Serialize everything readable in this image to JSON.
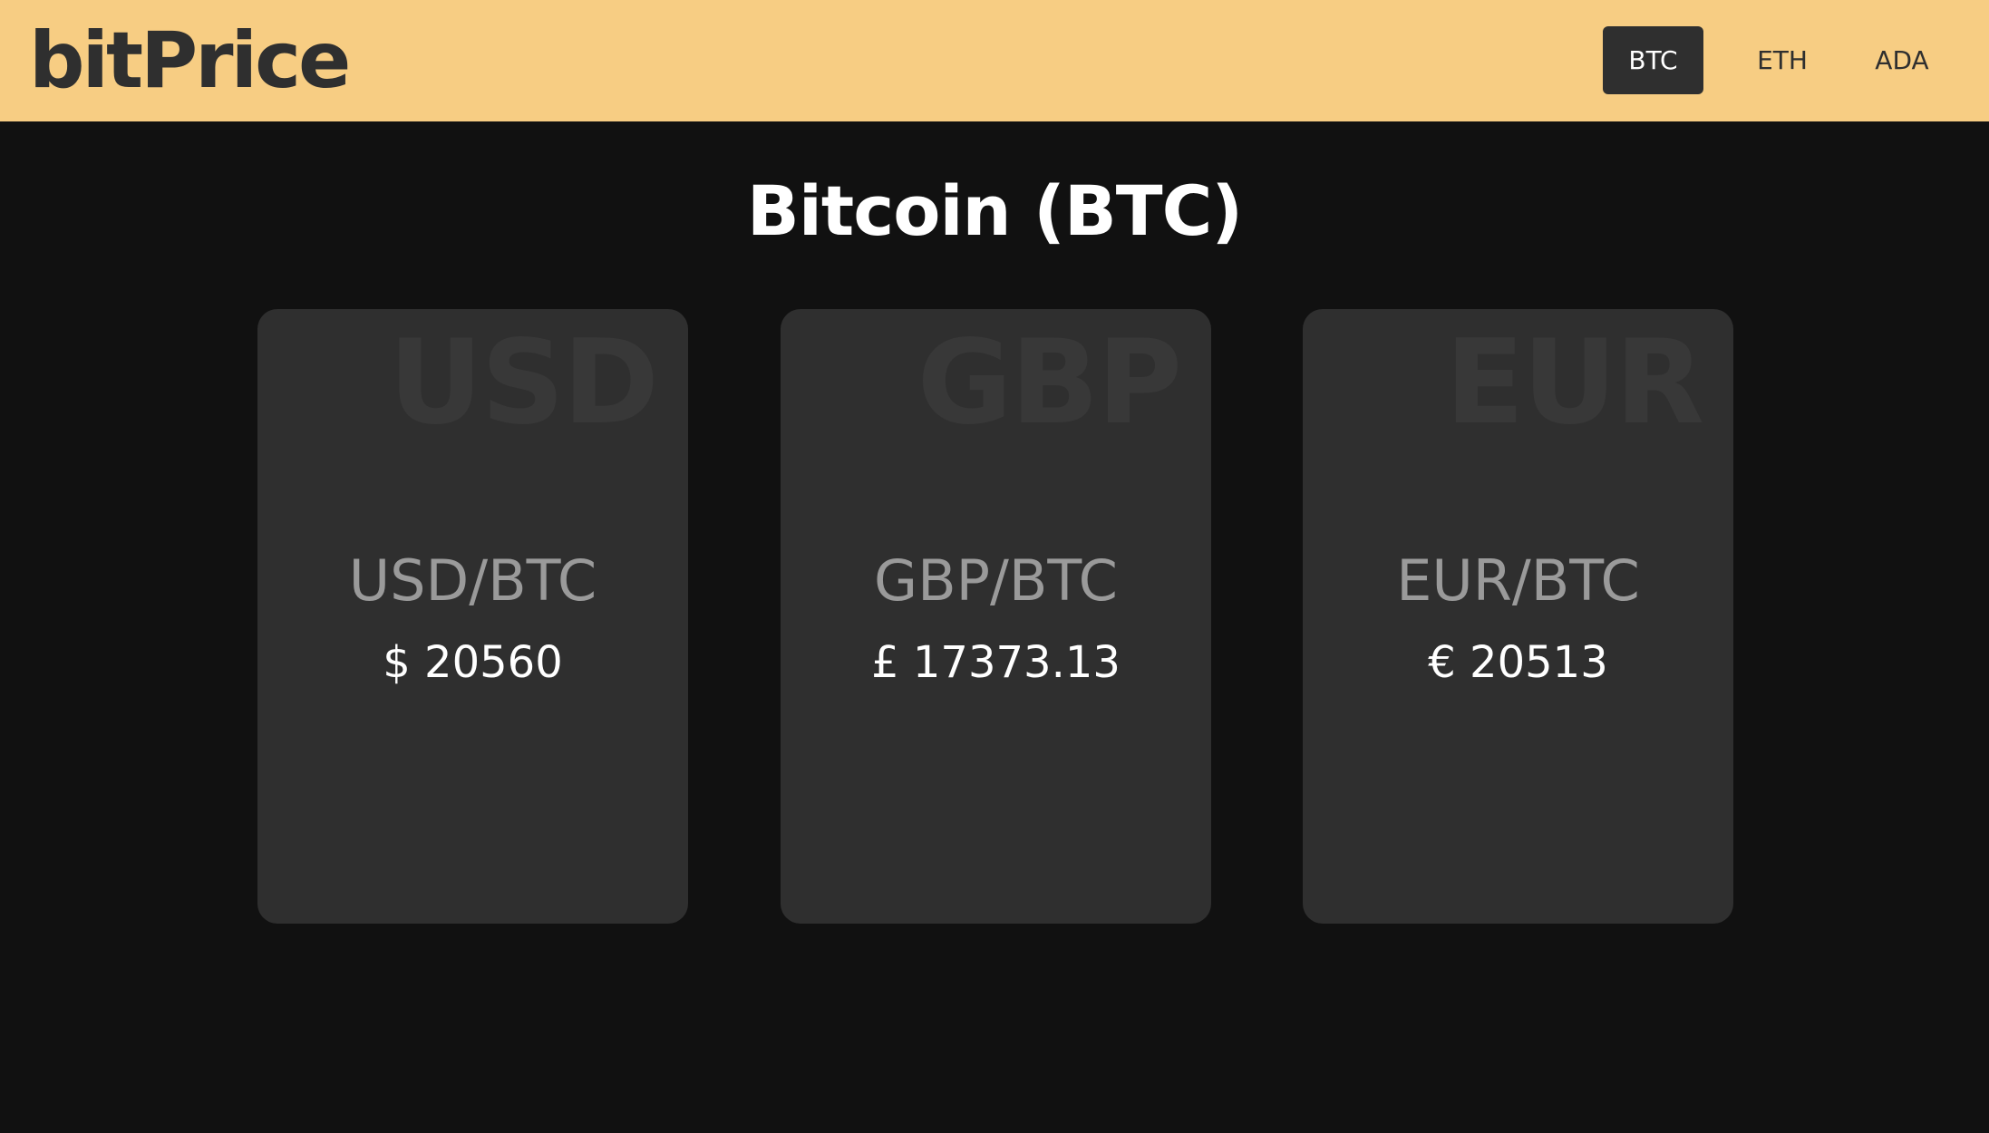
{
  "header": {
    "logo": "bitPrice",
    "nav": [
      {
        "label": "BTC",
        "active": true
      },
      {
        "label": "ETH",
        "active": false
      },
      {
        "label": "ADA",
        "active": false
      }
    ]
  },
  "main": {
    "title": "Bitcoin (BTC)",
    "cards": [
      {
        "watermark": "USD",
        "pair": "USD/BTC",
        "price": "$ 20560"
      },
      {
        "watermark": "GBP",
        "pair": "GBP/BTC",
        "price": "£ 17373.13"
      },
      {
        "watermark": "EUR",
        "pair": "EUR/BTC",
        "price": "€ 20513"
      }
    ]
  },
  "colors": {
    "header_bg": "#f7cd83",
    "page_bg": "#111111",
    "card_bg": "#2f2f2f",
    "active_nav_bg": "#2f2f2f"
  }
}
